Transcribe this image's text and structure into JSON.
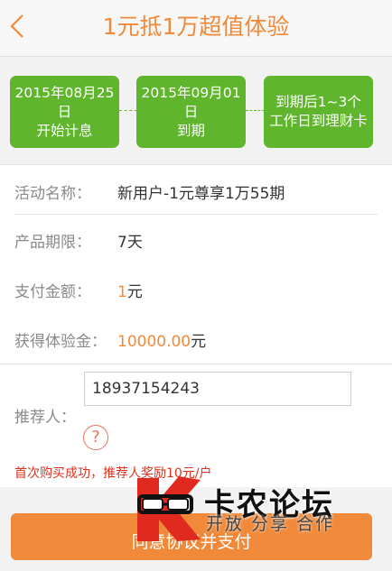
{
  "header": {
    "title": "1元抵1万超值体验",
    "back_icon": "chevron-left-icon"
  },
  "timeline": {
    "steps": [
      {
        "line1": "2015年08月25",
        "line2": "日",
        "line3": "开始计息"
      },
      {
        "line1": "2015年09月01",
        "line2": "日",
        "line3": "到期"
      },
      {
        "line1": "到期后1~3个",
        "line2": "工作日到理财卡",
        "line3": ""
      }
    ]
  },
  "info": {
    "activity_label": "活动名称：",
    "activity_value": "新用户-1元尊享1万55期",
    "term_label": "产品期限：",
    "term_value": "7天",
    "pay_label": "支付金额：",
    "pay_amount": "1",
    "pay_unit": "元",
    "gain_label": "获得体验金：",
    "gain_amount": "10000.00",
    "gain_unit": "元"
  },
  "referrer": {
    "label": "推荐人：",
    "value": "18937154243",
    "help_icon": "question-icon",
    "promo_text": "首次购买成功，推荐人奖励10元/户"
  },
  "submit": {
    "label": "同意协议并支付"
  },
  "watermark": {
    "title": "卡农论坛",
    "subtitle": "开放 分享 合作"
  },
  "colors": {
    "accent": "#f08a3a",
    "green": "#5fb52b",
    "promo": "#e0321f"
  }
}
